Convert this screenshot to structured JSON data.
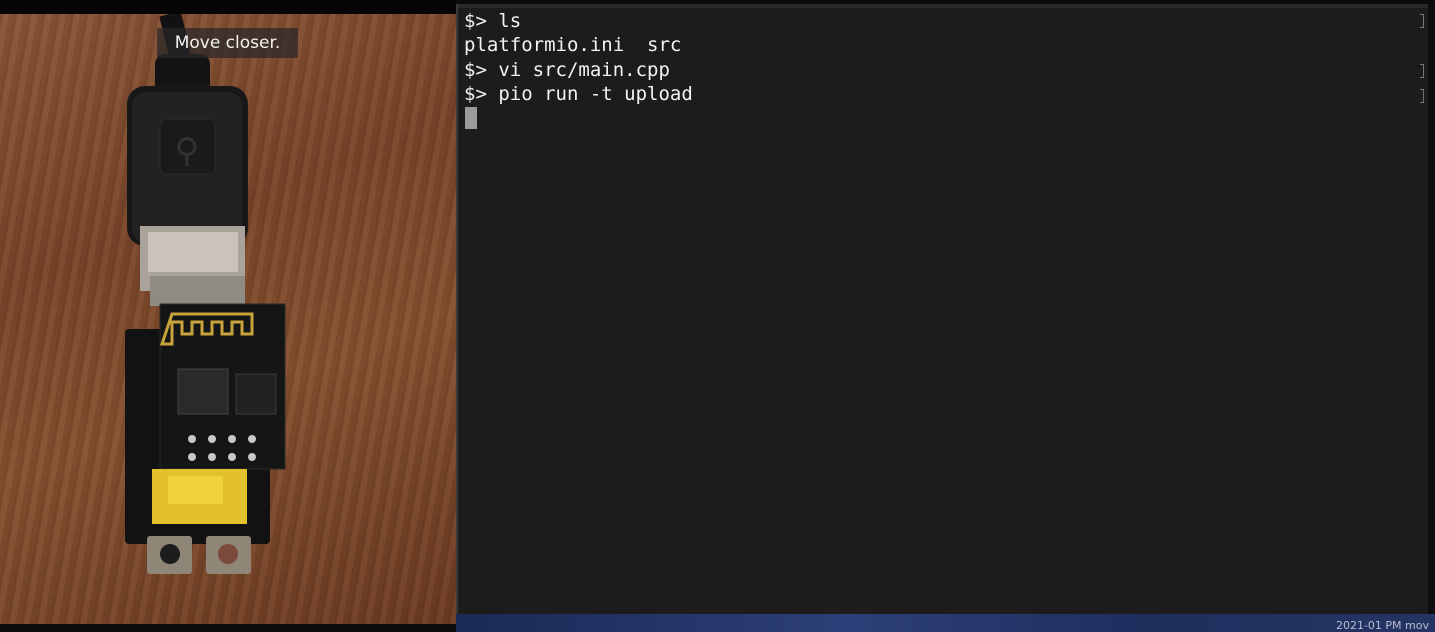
{
  "camera": {
    "hint": "Move closer."
  },
  "terminal": {
    "lines": [
      "$> ls",
      "platformio.ini  src",
      "$> vi src/main.cpp",
      "$> pio run -t upload"
    ]
  },
  "desktop": {
    "clock_fragment": "2021-01   PM mov"
  },
  "colors": {
    "terminal_bg": "#1c1c1c",
    "terminal_text": "#f3f3f3",
    "cursor": "#9b9b9b",
    "hint_bg": "#282828"
  }
}
